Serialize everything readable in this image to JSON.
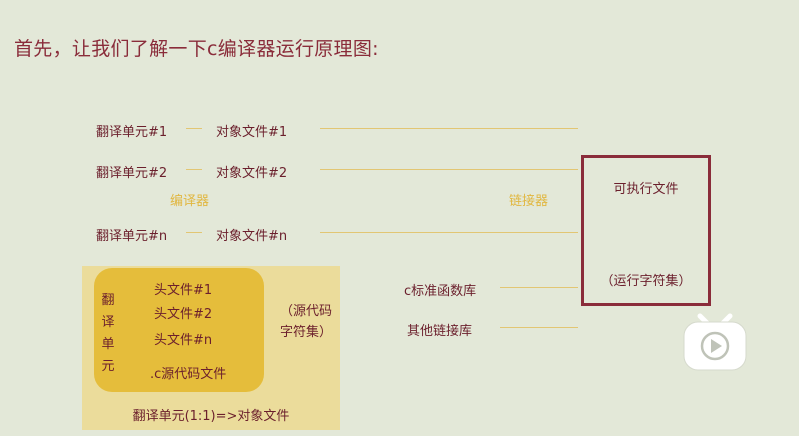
{
  "title": "首先，让我们了解一下c编译器运行原理图:",
  "units": [
    {
      "unit": "翻译单元#1",
      "object": "对象文件#1"
    },
    {
      "unit": "翻译单元#2",
      "object": "对象文件#2"
    },
    {
      "unit": "翻译单元#n",
      "object": "对象文件#n"
    }
  ],
  "compiler_label": "编译器",
  "linker_label": "链接器",
  "executable": {
    "label": "可执行文件",
    "sub": "（运行字符集）"
  },
  "libs": {
    "c_std": "c标准函数库",
    "other": "其他链接库"
  },
  "translation_unit": {
    "vertical_label": "翻译单元",
    "headers": [
      "头文件#1",
      "头文件#2",
      "头文件#n"
    ],
    "source": ".c源代码文件",
    "note": "（源代码字符集）",
    "mapping": "翻译单元(1:1)=>对象文件"
  },
  "colors": {
    "accent": "#8a2c3a",
    "yellow": "#e5bd3b",
    "panel": "#ebdc9b",
    "background": "#e3e8d8"
  },
  "icons": [
    "play-video-icon"
  ]
}
